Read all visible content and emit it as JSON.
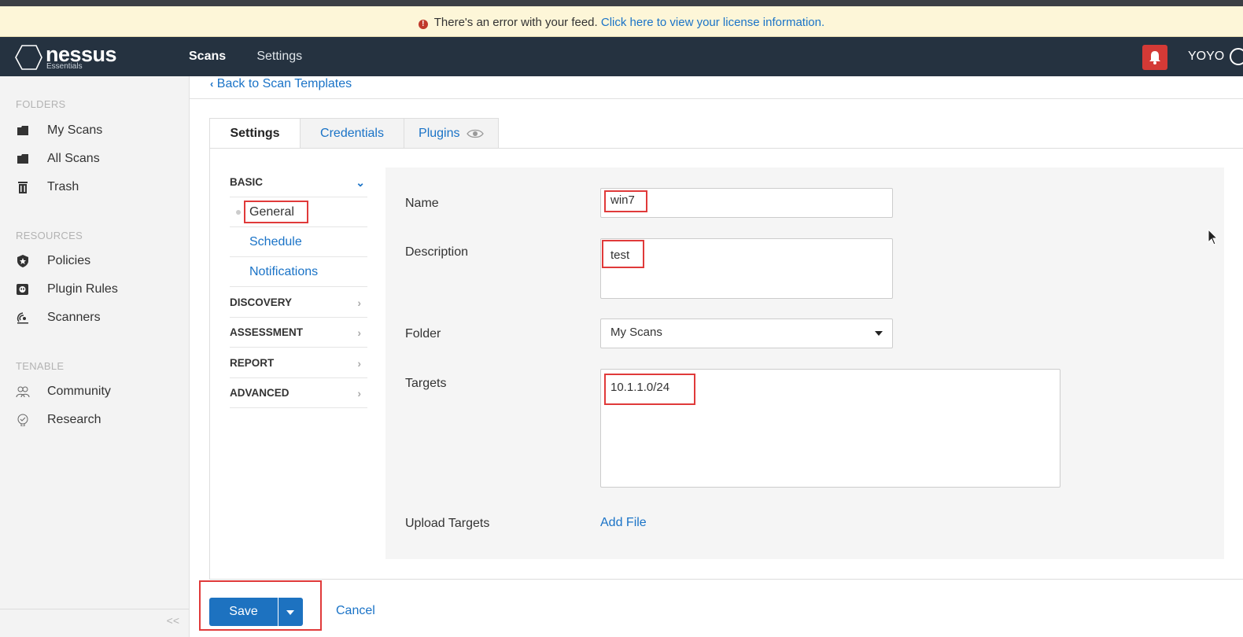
{
  "banner": {
    "message": "There's an error with your feed.",
    "link": "Click here to view your license information."
  },
  "header": {
    "brand": "nessus",
    "edition": "Essentials",
    "nav": [
      "Scans",
      "Settings"
    ],
    "user": "YOYO",
    "colors": {
      "header_bg": "#253240",
      "alert": "#d43a36",
      "link": "#1a73c7"
    }
  },
  "sidebar": {
    "folders_title": "FOLDERS",
    "folders": [
      {
        "label": "My Scans",
        "icon": "folder-icon"
      },
      {
        "label": "All Scans",
        "icon": "folder-icon"
      },
      {
        "label": "Trash",
        "icon": "trash-icon"
      }
    ],
    "resources_title": "RESOURCES",
    "resources": [
      {
        "label": "Policies",
        "icon": "policy-shield-icon"
      },
      {
        "label": "Plugin Rules",
        "icon": "plugin-rules-icon"
      },
      {
        "label": "Scanners",
        "icon": "scanner-icon"
      }
    ],
    "tenable_title": "TENABLE",
    "tenable": [
      {
        "label": "Community",
        "icon": "community-icon"
      },
      {
        "label": "Research",
        "icon": "research-icon"
      }
    ],
    "collapse": "<<"
  },
  "main": {
    "back": "Back to Scan Templates",
    "tabs": [
      "Settings",
      "Credentials",
      "Plugins"
    ],
    "subnav": {
      "basic": "BASIC",
      "basic_items": [
        "General",
        "Schedule",
        "Notifications"
      ],
      "sections": [
        "DISCOVERY",
        "ASSESSMENT",
        "REPORT",
        "ADVANCED"
      ]
    },
    "form": {
      "name_label": "Name",
      "name_value": "win7",
      "description_label": "Description",
      "description_value": "test",
      "folder_label": "Folder",
      "folder_value": "My Scans",
      "targets_label": "Targets",
      "targets_value": "10.1.1.0/24",
      "upload_label": "Upload Targets",
      "add_file": "Add File"
    },
    "save": "Save",
    "cancel": "Cancel"
  }
}
